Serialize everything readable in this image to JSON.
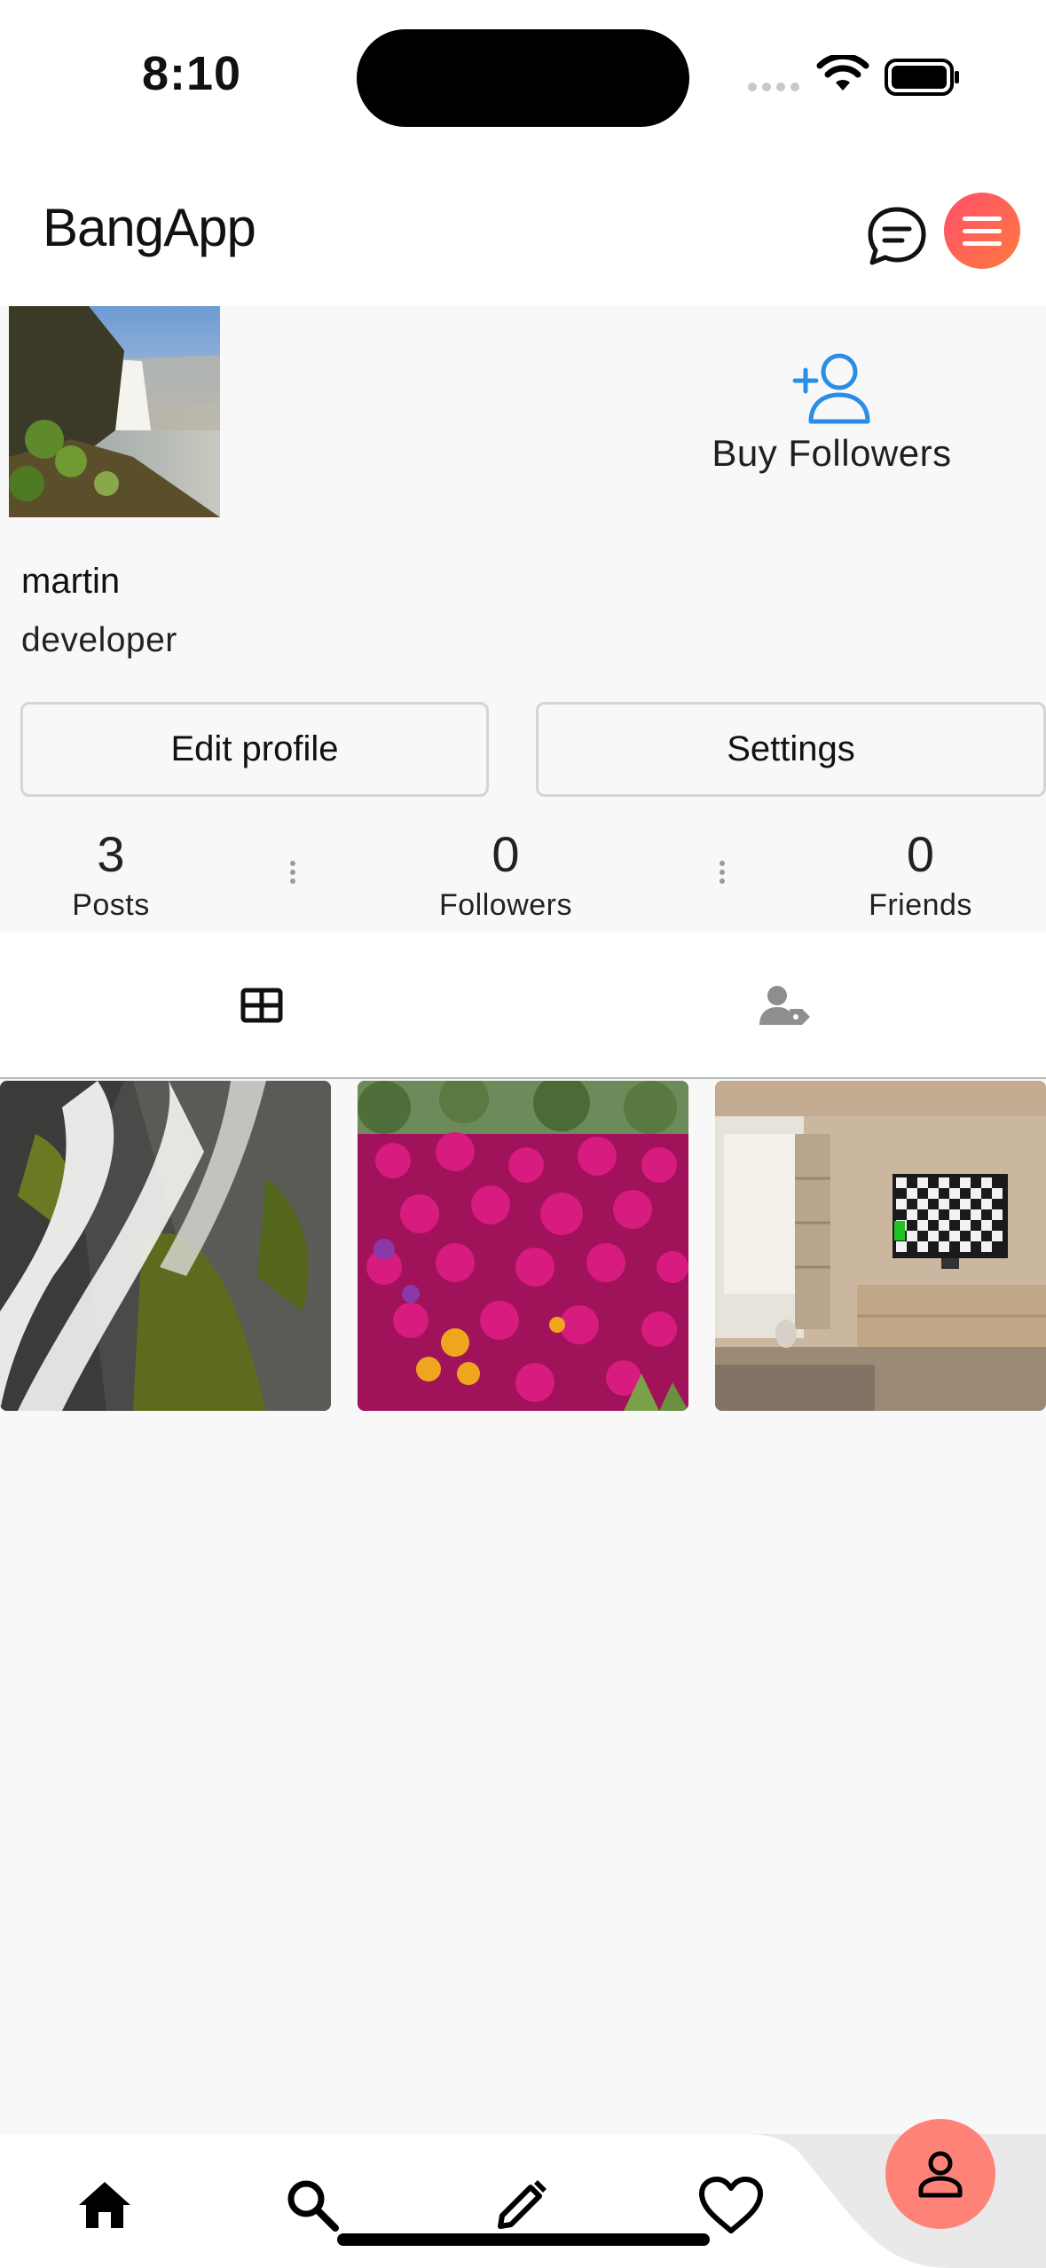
{
  "status_bar": {
    "time": "8:10"
  },
  "header": {
    "app_title": "BangApp"
  },
  "profile": {
    "username": "martin",
    "bio": "developer",
    "buy_followers_label": "Buy Followers",
    "edit_profile_label": "Edit profile",
    "settings_label": "Settings"
  },
  "stats": [
    {
      "value": "3",
      "label": "Posts"
    },
    {
      "value": "0",
      "label": "Followers"
    },
    {
      "value": "0",
      "label": "Friends"
    }
  ],
  "tabs": [
    {
      "icon": "grid-icon",
      "active": true
    },
    {
      "icon": "tagged-user-icon",
      "active": false
    }
  ],
  "posts": [
    {
      "subject": "waterfall-photo"
    },
    {
      "subject": "flowers-photo"
    },
    {
      "subject": "room-tv-photo"
    }
  ],
  "bottom_nav": [
    {
      "icon": "home-icon"
    },
    {
      "icon": "search-icon"
    },
    {
      "icon": "pencil-icon"
    },
    {
      "icon": "heart-icon"
    },
    {
      "icon": "person-icon",
      "active": true
    }
  ],
  "colors": {
    "menu_gradient_start": "#ff4f6d",
    "menu_gradient_end": "#ff7a3d",
    "buy_followers_blue": "#2a8ee6",
    "profile_nav_bg": "#ff8278"
  }
}
